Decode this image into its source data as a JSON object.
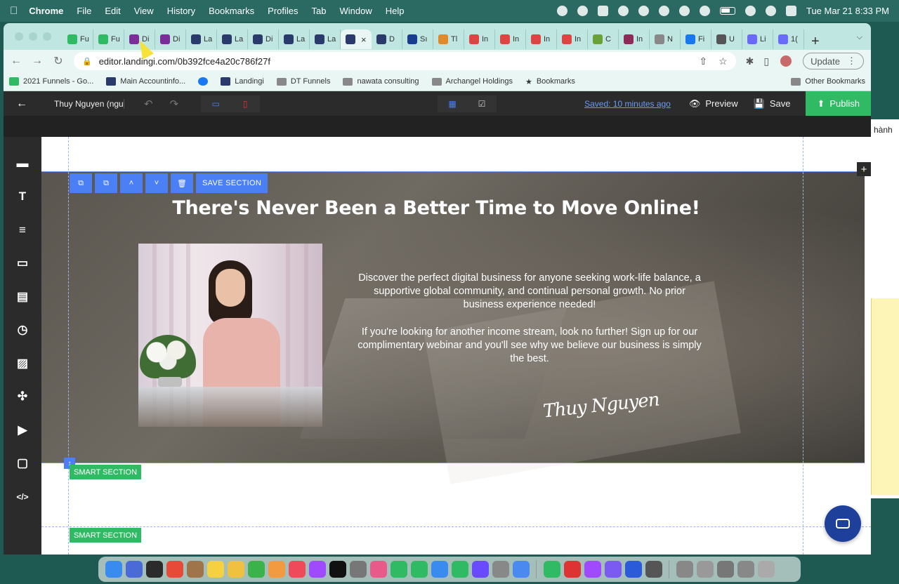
{
  "menubar": {
    "app": "Chrome",
    "items": [
      "File",
      "Edit",
      "View",
      "History",
      "Bookmarks",
      "Profiles",
      "Tab",
      "Window",
      "Help"
    ],
    "datetime": "Tue Mar 21  8:33 PM"
  },
  "browser": {
    "tabs": [
      {
        "label": "Fu",
        "color": "#2fba63"
      },
      {
        "label": "Fu",
        "color": "#2fba63"
      },
      {
        "label": "Di",
        "color": "#7b2d9a"
      },
      {
        "label": "Di",
        "color": "#7b2d9a"
      },
      {
        "label": "La",
        "color": "#2a3a6b"
      },
      {
        "label": "La",
        "color": "#2a3a6b"
      },
      {
        "label": "Di",
        "color": "#2a3a6b"
      },
      {
        "label": "La",
        "color": "#2a3a6b"
      },
      {
        "label": "La",
        "color": "#2a3a6b"
      },
      {
        "label": "",
        "color": "#2a3a6b",
        "active": true
      },
      {
        "label": "D",
        "color": "#2a3a6b"
      },
      {
        "label": "Sı",
        "color": "#1a3e8f"
      },
      {
        "label": "Tl",
        "color": "#e08a2c"
      },
      {
        "label": "In",
        "color": "#d44"
      },
      {
        "label": "In",
        "color": "#d44"
      },
      {
        "label": "In",
        "color": "#d44"
      },
      {
        "label": "In",
        "color": "#d44"
      },
      {
        "label": "C",
        "color": "#6aa23a"
      },
      {
        "label": "In",
        "color": "#8e2a5a"
      },
      {
        "label": "N",
        "color": "#888"
      },
      {
        "label": "Fi",
        "color": "#1877f2"
      },
      {
        "label": "U",
        "color": "#555"
      },
      {
        "label": "Li",
        "color": "#6a6aff"
      },
      {
        "label": "1(",
        "color": "#6a6aff"
      }
    ],
    "url": "editor.landingi.com/0b392fce4a20c786f27f",
    "update_label": "Update",
    "bookmarks": [
      {
        "label": "2021 Funnels - Go...",
        "type": "sheet"
      },
      {
        "label": "Main Accountinfo...",
        "type": "landingi"
      },
      {
        "label": "",
        "type": "facebook"
      },
      {
        "label": "Landingi",
        "type": "landingi"
      },
      {
        "label": "DT Funnels",
        "type": "folder"
      },
      {
        "label": "nawata consulting",
        "type": "folder"
      },
      {
        "label": "Archangel Holdings",
        "type": "folder"
      },
      {
        "label": "Bookmarks",
        "type": "star"
      }
    ],
    "other_bookmarks": "Other Bookmarks"
  },
  "editor": {
    "page_name": "Thuy Nguyen (nguy...",
    "saved_label": "Saved: 10 minutes ago",
    "preview_label": "Preview",
    "save_label": "Save",
    "publish_label": "Publish",
    "save_section_label": "SAVE SECTION",
    "smart_section_label": "SMART SECTION",
    "left_tools": [
      "section-icon",
      "text-icon",
      "layout-icon",
      "button-icon",
      "form-icon",
      "timer-icon",
      "image-icon",
      "icons-icon",
      "video-icon",
      "shape-icon",
      "code-icon"
    ]
  },
  "hero": {
    "title": "There's Never Been a Better Time to Move Online!",
    "paragraph1": "Discover the perfect digital business for anyone seeking work-life balance, a supportive global community, and continual personal growth. No prior business experience needed!",
    "paragraph2": "If you're looking for another income stream, look no further! Sign up for our complimentary webinar and you'll see why we believe our business is simply the best.",
    "signature": "Thuy Nguyen"
  },
  "background_window": {
    "snippet": "hành"
  },
  "colors": {
    "accent_blue": "#4a7ff5",
    "publish_green": "#2fba63",
    "menubar": "#2a6a63",
    "tabstrip": "#bfe6e0"
  }
}
